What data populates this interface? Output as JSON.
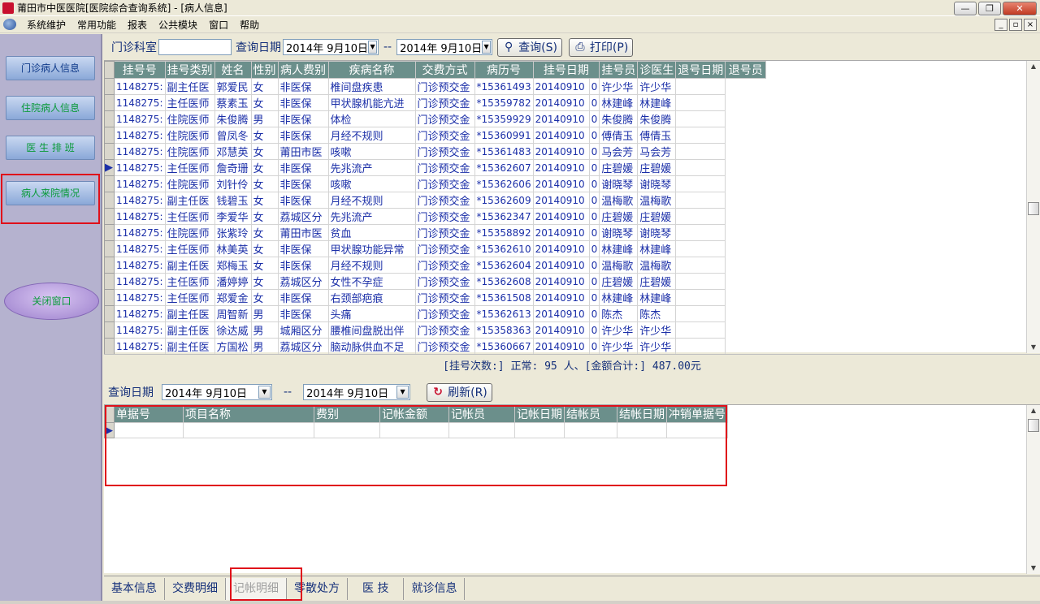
{
  "window": {
    "title": "莆田市中医医院[医院综合查询系统] - [病人信息]",
    "min": "0",
    "restore": "1",
    "close": "r"
  },
  "menu": [
    "系统维护",
    "常用功能",
    "报表",
    "公共模块",
    "窗口",
    "帮助"
  ],
  "mdi": {
    "min": "_",
    "restore": "▫",
    "close": "×"
  },
  "sidebar": {
    "items": [
      "门诊病人信息",
      "住院病人信息",
      "医 生 排 班",
      "病人来院情况"
    ],
    "oval": "关闭窗口"
  },
  "toolbar": {
    "dept_label": "门诊科室",
    "dept_value": "",
    "date_label": "查询日期",
    "date_from": "2014年 9月10日",
    "date_to": "2014年 9月10日",
    "sep": "--",
    "query_btn": "查询(S)",
    "print_btn": "打印(P)"
  },
  "grid": {
    "columns": [
      "挂号号",
      "挂号类别",
      "姓名",
      "性别",
      "病人费别",
      "疾病名称",
      "交费方式",
      "病历号",
      "挂号日期",
      "挂号员",
      "诊医生",
      "退号日期",
      "退号员"
    ],
    "rows": [
      [
        "1148275:",
        "副主任医",
        "郭爱民",
        "女",
        "非医保",
        "椎间盘疾患",
        "门诊预交金",
        "*15361493",
        "20140910",
        "0",
        "许少华",
        "许少华",
        ""
      ],
      [
        "1148275:",
        "主任医师",
        "蔡素玉",
        "女",
        "非医保",
        "甲状腺机能亢进",
        "门诊预交金",
        "*15359782",
        "20140910",
        "0",
        "林建峰",
        "林建峰",
        ""
      ],
      [
        "1148275:",
        "住院医师",
        "朱俊腾",
        "男",
        "非医保",
        "体检",
        "门诊预交金",
        "*15359929",
        "20140910",
        "0",
        "朱俊腾",
        "朱俊腾",
        ""
      ],
      [
        "1148275:",
        "住院医师",
        "曾凤冬",
        "女",
        "非医保",
        "月经不规则",
        "门诊预交金",
        "*15360991",
        "20140910",
        "0",
        "傅倩玉",
        "傅倩玉",
        ""
      ],
      [
        "1148275:",
        "住院医师",
        "邓慧英",
        "女",
        "莆田市医",
        "咳嗽",
        "门诊预交金",
        "*15361483",
        "20140910",
        "0",
        "马会芳",
        "马会芳",
        ""
      ],
      [
        "1148275:",
        "主任医师",
        "詹奇珊",
        "女",
        "非医保",
        "先兆流产",
        "门诊预交金",
        "*15362607",
        "20140910",
        "0",
        "庄碧媛",
        "庄碧媛",
        ""
      ],
      [
        "1148275:",
        "住院医师",
        "刘针伶",
        "女",
        "非医保",
        "咳嗽",
        "门诊预交金",
        "*15362606",
        "20140910",
        "0",
        "谢晓琴",
        "谢晓琴",
        ""
      ],
      [
        "1148275:",
        "副主任医",
        "钱碧玉",
        "女",
        "非医保",
        "月经不规则",
        "门诊预交金",
        "*15362609",
        "20140910",
        "0",
        "温梅歌",
        "温梅歌",
        ""
      ],
      [
        "1148275:",
        "主任医师",
        "李爱华",
        "女",
        "荔城区分",
        "先兆流产",
        "门诊预交金",
        "*15362347",
        "20140910",
        "0",
        "庄碧媛",
        "庄碧媛",
        ""
      ],
      [
        "1148275:",
        "住院医师",
        "张紫玲",
        "女",
        "莆田市医",
        "贫血",
        "门诊预交金",
        "*15358892",
        "20140910",
        "0",
        "谢晓琴",
        "谢晓琴",
        ""
      ],
      [
        "1148275:",
        "主任医师",
        "林美英",
        "女",
        "非医保",
        "甲状腺功能异常",
        "门诊预交金",
        "*15362610",
        "20140910",
        "0",
        "林建峰",
        "林建峰",
        ""
      ],
      [
        "1148275:",
        "副主任医",
        "郑梅玉",
        "女",
        "非医保",
        "月经不规则",
        "门诊预交金",
        "*15362604",
        "20140910",
        "0",
        "温梅歌",
        "温梅歌",
        ""
      ],
      [
        "1148275:",
        "主任医师",
        "潘婷婷",
        "女",
        "荔城区分",
        "女性不孕症",
        "门诊预交金",
        "*15362608",
        "20140910",
        "0",
        "庄碧媛",
        "庄碧媛",
        ""
      ],
      [
        "1148275:",
        "主任医师",
        "郑爱金",
        "女",
        "非医保",
        "右颈部疤痕",
        "门诊预交金",
        "*15361508",
        "20140910",
        "0",
        "林建峰",
        "林建峰",
        ""
      ],
      [
        "1148275:",
        "副主任医",
        "周智新",
        "男",
        "非医保",
        "头痛",
        "门诊预交金",
        "*15362613",
        "20140910",
        "0",
        "陈杰",
        "陈杰",
        ""
      ],
      [
        "1148275:",
        "副主任医",
        "徐达威",
        "男",
        "城厢区分",
        "腰椎间盘脱出伴",
        "门诊预交金",
        "*15358363",
        "20140910",
        "0",
        "许少华",
        "许少华",
        ""
      ],
      [
        "1148275:",
        "副主任医",
        "方国松",
        "男",
        "荔城区分",
        "脑动脉供血不足",
        "门诊预交金",
        "*15360667",
        "20140910",
        "0",
        "许少华",
        "许少华",
        ""
      ]
    ]
  },
  "summary": "[挂号次数:] 正常: 95 人、[金额合计:] 487.00元",
  "query2": {
    "date_label": "查询日期",
    "date_from": "2014年 9月10日",
    "sep": "--",
    "date_to": "2014年 9月10日",
    "refresh_btn": "刷新(R)"
  },
  "grid2": {
    "columns": [
      "单据号",
      "项目名称",
      "费别",
      "记帐金额",
      "记帐员",
      "记帐日期",
      "结帐员",
      "结帐日期",
      "冲销单据号"
    ]
  },
  "tabs": [
    "基本信息",
    "交费明细",
    "记帐明细",
    "零散处方",
    "医  技",
    "就诊信息"
  ],
  "active_tab_index": 2,
  "colors": {
    "header_bg": "#6b8f8b",
    "cell_text": "#1b2fa8",
    "highlight_box": "#e0101a"
  }
}
